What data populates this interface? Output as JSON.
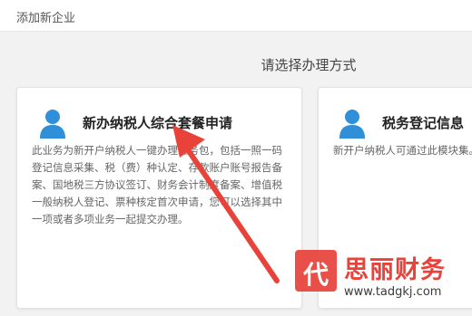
{
  "window": {
    "title": "添加新企业"
  },
  "main": {
    "heading": "请选择办理方式",
    "cards": [
      {
        "icon": "user-icon",
        "title": "新办纳税人综合套餐申请",
        "description": "此业务为新开户纳税人一键办理业务包，包括一照一码登记信息采集、税（费）种认定、存款账户账号报告备案、国地税三方协议签订、财务会计制度备案、增值税一般纳税人登记、票种核定首次申请，您可以选择其中一项或者多项业务一起提交办理。"
      },
      {
        "icon": "user-icon",
        "title": "税务登记信息",
        "description": "新开户纳税人可通过此模块集。"
      }
    ]
  },
  "watermark": {
    "logo_char": "代",
    "name": "思丽财务",
    "url": "www.tadgkj.com"
  },
  "colors": {
    "accent_blue": "#2f8fd8",
    "arrow_red": "#e8423a",
    "background": "#f2f2f2"
  }
}
